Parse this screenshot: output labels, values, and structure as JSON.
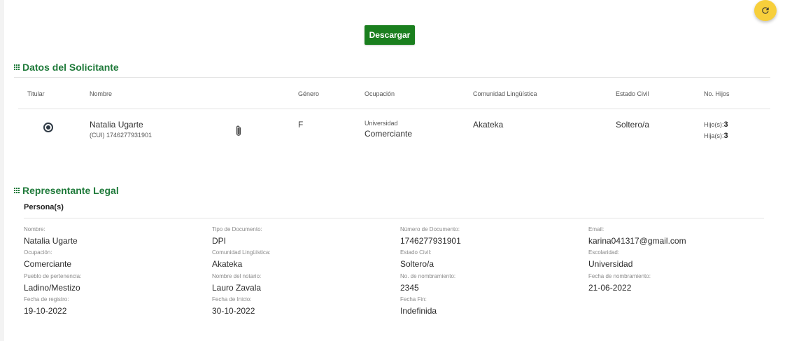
{
  "actions": {
    "download_label": "Descargar"
  },
  "applicant": {
    "title": "Datos del Solicitante",
    "headers": {
      "titular": "Titular",
      "nombre": "Nombre",
      "genero": "Género",
      "ocupacion": "Ocupación",
      "comunidad": "Comunidad Lingüística",
      "estado_civil": "Estado Civil",
      "no_hijos": "No. Hijos"
    },
    "row": {
      "name": "Natalia Ugarte",
      "cui": "(CUI) 1746277931901",
      "gender": "F",
      "education": "Universidad",
      "occupation": "Comerciante",
      "community": "Akateka",
      "civil_status": "Soltero/a",
      "sons_label": "Hijo(s):",
      "sons_value": "3",
      "daughters_label": "Hija(s):",
      "daughters_value": "3"
    }
  },
  "legal_rep": {
    "title": "Representante Legal",
    "subtitle": "Persona(s)",
    "fields": {
      "nombre": {
        "label": "Nombre:",
        "value": "Natalia Ugarte"
      },
      "tipo_documento": {
        "label": "Tipo de Documento:",
        "value": "DPI"
      },
      "numero_documento": {
        "label": "Número de Documento:",
        "value": "1746277931901"
      },
      "email": {
        "label": "Email:",
        "value": "karina041317@gmail.com"
      },
      "ocupacion": {
        "label": "Ocupación:",
        "value": "Comerciante"
      },
      "comunidad": {
        "label": "Comunidad Lingüística:",
        "value": "Akateka"
      },
      "estado_civil": {
        "label": "Estado Civil:",
        "value": "Soltero/a"
      },
      "escolaridad": {
        "label": "Escolaridad:",
        "value": "Universidad"
      },
      "pueblo": {
        "label": "Pueblo de pertenencia:",
        "value": "Ladino/Mestizo"
      },
      "notario": {
        "label": "Nombre del notario:",
        "value": "Lauro Zavala"
      },
      "no_nombramiento": {
        "label": "No. de nombramiento:",
        "value": "2345"
      },
      "fecha_nombramiento": {
        "label": "Fecha de nombramiento:",
        "value": "21-06-2022"
      },
      "fecha_registro": {
        "label": "Fecha de registro:",
        "value": "19-10-2022"
      },
      "fecha_inicio": {
        "label": "Fecha de Inicio:",
        "value": "30-10-2022"
      },
      "fecha_fin": {
        "label": "Fecha Fin:",
        "value": "Indefinida"
      }
    }
  },
  "colors": {
    "primary_green": "#1a7f1e",
    "title_green": "#1f7a3a",
    "fab_yellow": "#f7cf3b"
  },
  "icons": {
    "refresh": "refresh-icon",
    "attachment": "paperclip-icon",
    "section": "grid-icon"
  }
}
